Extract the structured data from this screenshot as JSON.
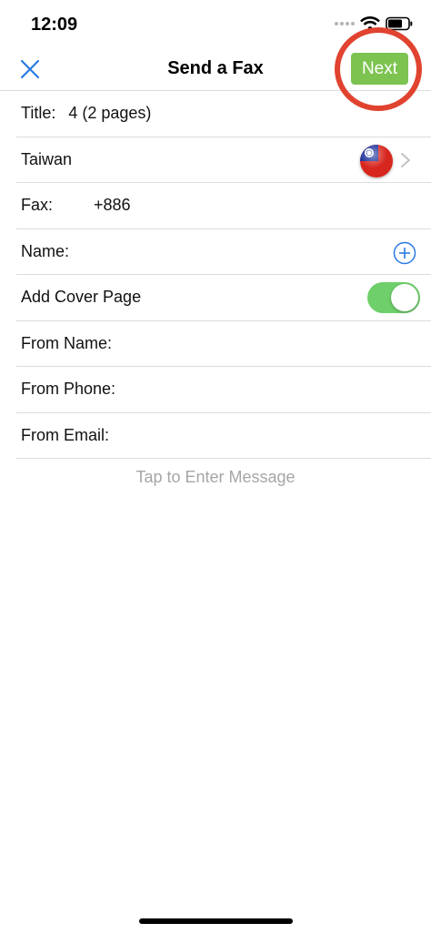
{
  "status_bar": {
    "time": "12:09"
  },
  "nav": {
    "title": "Send a Fax",
    "next_label": "Next"
  },
  "form": {
    "title_label": "Title:",
    "title_value": "4 (2 pages)",
    "country": "Taiwan",
    "fax_label": "Fax:",
    "fax_value": "+886",
    "name_label": "Name:",
    "cover_page_label": "Add Cover Page",
    "cover_page_enabled": true,
    "from_name_label": "From Name:",
    "from_phone_label": "From Phone:",
    "from_email_label": "From Email:"
  },
  "message": {
    "placeholder": "Tap to Enter Message"
  },
  "icons": {
    "close": "close-icon",
    "flag": "taiwan-flag-icon",
    "chevron": "chevron-right-icon",
    "add": "add-circle-icon",
    "wifi": "wifi-icon",
    "battery": "battery-icon"
  },
  "colors": {
    "accent_blue": "#2a7ae2",
    "next_green": "#7cc350",
    "toggle_green": "#6fcf6a",
    "highlight_red": "#e0432f"
  }
}
